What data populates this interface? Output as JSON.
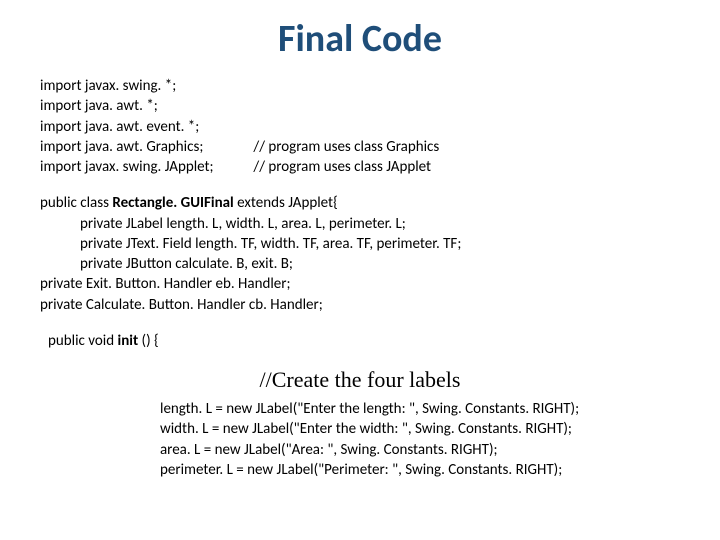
{
  "title": "Final Code",
  "imports": {
    "l1": "import javax. swing. *;",
    "l2": "import java. awt. *;",
    "l3": "import java. awt. event. *;",
    "l4a": "import java. awt. Graphics;",
    "l4b": "// program uses class Graphics",
    "l5a": "import javax. swing. JApplet;",
    "l5b": "// program uses class JApplet"
  },
  "classdecl": {
    "pre": "public class ",
    "name": "Rectangle. GUIFinal",
    "post": " extends JApplet{",
    "f1": "private JLabel length. L, width. L, area. L, perimeter. L;",
    "f2": "private JText. Field length. TF, width. TF, area. TF, perimeter. TF;",
    "f3": "private JButton calculate. B, exit. B;",
    "f4": "private Exit. Button. Handler eb. Handler;",
    "f5": "private Calculate. Button. Handler cb. Handler;"
  },
  "init": {
    "sig_pre": "public void ",
    "sig_mid": "init ",
    "sig_post": "() {",
    "comment": "//Create the four labels",
    "a1": "length. L = new JLabel(\"Enter the length: \", Swing. Constants. RIGHT);",
    "a2": "width. L = new JLabel(\"Enter the width: \", Swing. Constants. RIGHT);",
    "a3": "area. L = new JLabel(\"Area: \", Swing. Constants. RIGHT);",
    "a4": " perimeter. L = new JLabel(\"Perimeter: \", Swing. Constants. RIGHT);"
  }
}
